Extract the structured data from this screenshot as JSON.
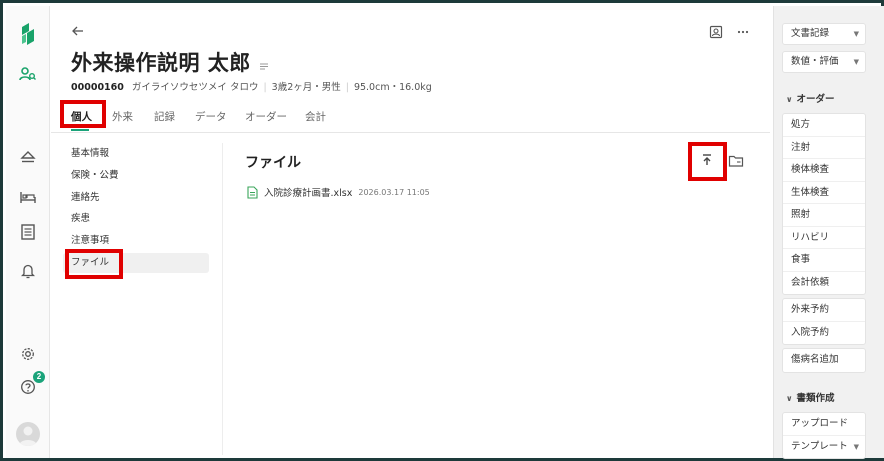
{
  "patient": {
    "name": "外来操作説明 太郎",
    "id": "00000160",
    "kana": "ガイライソウセツメイ タロウ",
    "age_sex": "3歳2ヶ月・男性",
    "body": "95.0cm・16.0kg"
  },
  "tabs": [
    "個人",
    "外来",
    "記録",
    "データ",
    "オーダー",
    "会計"
  ],
  "active_tab": "個人",
  "side_menu": [
    "基本情報",
    "保険・公費",
    "連絡先",
    "疾患",
    "注意事項",
    "ファイル"
  ],
  "active_menu": "ファイル",
  "content": {
    "title": "ファイル",
    "files": [
      {
        "name": "入院診療計画書.xlsx",
        "date": "2026.03.17 11:05"
      }
    ]
  },
  "right_panel": {
    "top_buttons": [
      "文書記録",
      "数値・評価"
    ],
    "order_section": "オーダー",
    "orders": [
      "処方",
      "注射",
      "検体検査",
      "生体検査",
      "照射",
      "リハビリ",
      "食事",
      "会計依頼"
    ],
    "reservations": [
      "外来予約",
      "入院予約"
    ],
    "disease": "傷病名追加",
    "docs_section": "書類作成",
    "docs": [
      "アップロード",
      "テンプレート"
    ]
  },
  "rail": {
    "help_badge": "2"
  },
  "colors": {
    "accent": "#1aa37a",
    "highlight": "#e00000",
    "brand": "#19a36a"
  }
}
